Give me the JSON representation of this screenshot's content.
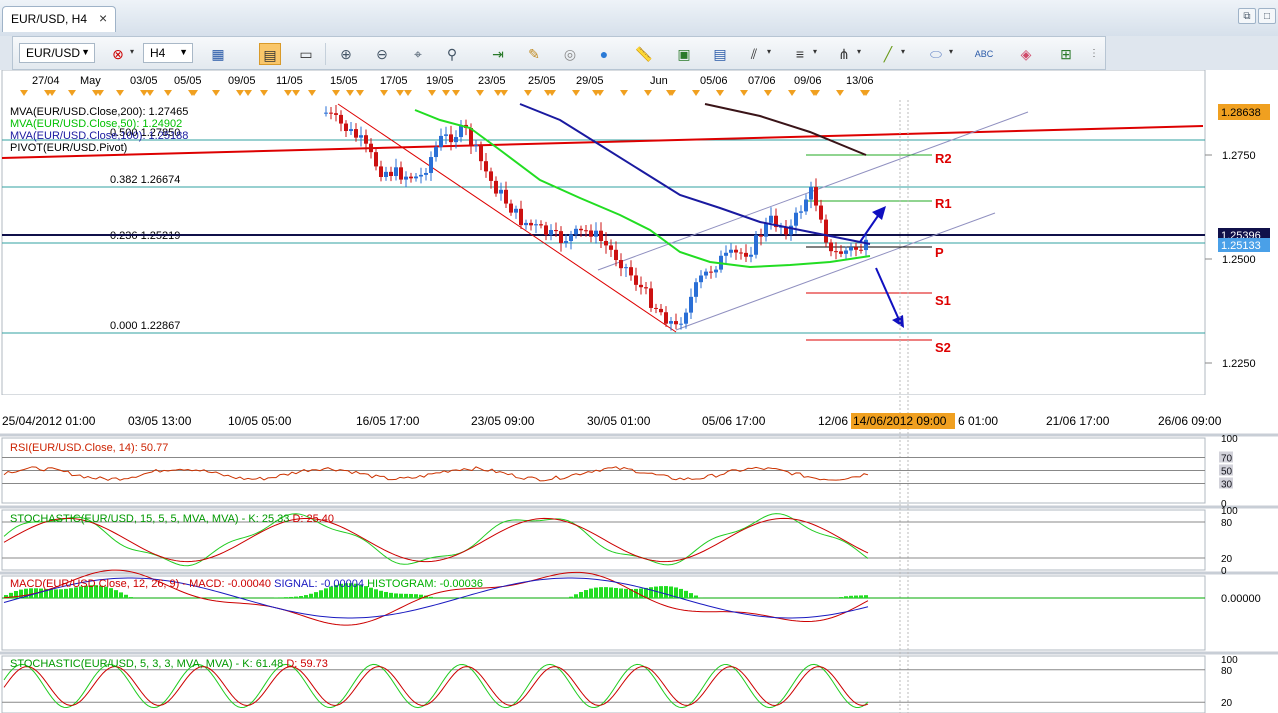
{
  "tab": {
    "title": "EUR/USD, H4",
    "close": "×"
  },
  "window_buttons": [
    "⧉",
    "□"
  ],
  "toolbar": {
    "symbol": "EUR/USD",
    "timeframe": "H4",
    "icons": [
      "indicators-icon",
      "crosshair-icon",
      "bar-chart-icon",
      "text-label-icon",
      "zoom-in-icon",
      "zoom-out-icon",
      "data-window-icon",
      "magnifier-icon",
      "chart-fit-icon",
      "pencil-icon",
      "globe-icon",
      "navigation-icon",
      "ruler-icon",
      "chart-image-icon",
      "screenshot-icon",
      "drawing-lines-icon",
      "fibonacci-icon",
      "pitchfork-icon",
      "trendline-icon",
      "ellipse-icon",
      "text-icon",
      "eraser-icon",
      "object-tree-icon",
      "more-icon"
    ]
  },
  "top_dates": [
    "27/04",
    "May",
    "03/05",
    "05/05",
    "09/05",
    "11/05",
    "15/05",
    "17/05",
    "19/05",
    "23/05",
    "25/05",
    "29/05",
    "Jun",
    "05/06",
    "07/06",
    "09/06",
    "13/06"
  ],
  "bottom_dates": [
    "25/04/2012 01:00",
    "03/05 13:00",
    "10/05 05:00",
    "16/05 17:00",
    "23/05 09:00",
    "30/05 01:00",
    "05/06 17:00",
    "12/06",
    "6 01:00",
    "21/06 17:00",
    "26/06 09:00"
  ],
  "cursor_time": "14/06/2012 09:00",
  "main_legend": [
    {
      "text": "MVA(EUR/USD.Close,200): 1.27465",
      "color": "#000000"
    },
    {
      "text": "MVA(EUR/USD.Close,50): 1.24902",
      "color": "#00d000"
    },
    {
      "text": "MVA(EUR/USD.Close,100): 1.25188",
      "color": "#1a1aa0"
    },
    {
      "text": "PIVOT(EUR/USD.Pivot)",
      "color": "#000000"
    }
  ],
  "fib_labels": [
    "0.500 1.27850",
    "0.382 1.26674",
    "0.236 1.25219",
    "0.000 1.22867"
  ],
  "pivot_labels": [
    "R2",
    "R1",
    "P",
    "S1",
    "S2"
  ],
  "price_axis": {
    "ticks": [
      "1.2750",
      "1.2500",
      "1.2250"
    ],
    "top_label": "1.28638",
    "current_dark": "1.25396",
    "current_blue": "1.25133"
  },
  "rsi": {
    "legend": "RSI(EUR/USD.Close, 14): 50.77",
    "ticks": [
      "100",
      "70",
      "50",
      "30",
      "0"
    ]
  },
  "stoch1": {
    "legend_name": "STOCHASTIC(EUR/USD, 15, 5, 5, MVA, MVA)  -",
    "k": "K: 25.33",
    "d": "D: 25.40",
    "ticks": [
      "100",
      "80",
      "20",
      "0"
    ]
  },
  "macd": {
    "legend_name": "MACD(EUR/USD.Close, 12, 26, 9)  -",
    "macd": "MACD: -0.00040",
    "signal": "SIGNAL: -0.00004",
    "hist": "HISTOGRAM: -0.00036",
    "tick": "0.00000"
  },
  "stoch2": {
    "legend_name": "STOCHASTIC(EUR/USD, 5, 3, 3, MVA, MVA)  -",
    "k": "K: 61.48",
    "d": "D: 59.73",
    "ticks": [
      "100",
      "80",
      "20"
    ]
  },
  "colors": {
    "bull": "#2a6fd6",
    "bear": "#cc1111",
    "ma50": "#22dd22",
    "ma100": "#1a1aa0",
    "ma200": "#3a1418",
    "pivot_red": "#dd0000",
    "fib": "#30a0a0"
  }
}
